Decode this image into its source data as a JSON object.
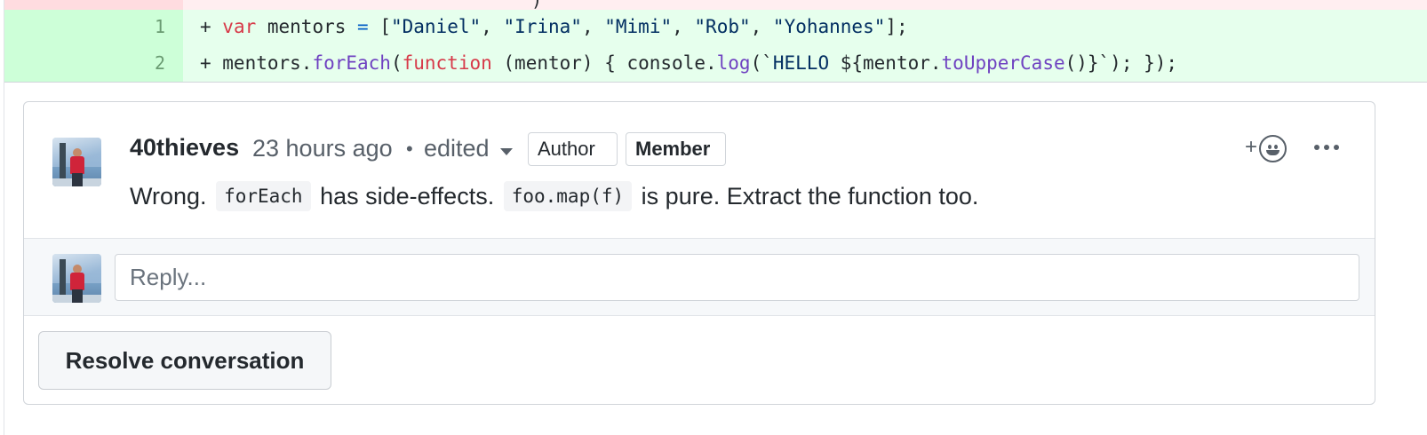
{
  "diff": {
    "removed_partial_glyph": ")",
    "lines": [
      {
        "number": "1"
      },
      {
        "number": "2"
      }
    ]
  },
  "comment": {
    "author": "40thieves",
    "timestamp": "23 hours ago",
    "separator": "•",
    "edited_label": "edited",
    "labels": {
      "author": "Author",
      "member": "Member"
    },
    "reaction_plus": "+",
    "body": {
      "seg1": "Wrong.",
      "code1": "forEach",
      "seg2": "has side-effects.",
      "code2": "foo.map(f)",
      "seg3": "is pure. Extract the function too."
    },
    "icons": {
      "reaction": "smiley-icon",
      "more": "kebab-horizontal-icon",
      "caret": "caret-down-icon"
    }
  },
  "reply": {
    "placeholder": "Reply..."
  },
  "resolve": {
    "label": "Resolve conversation"
  },
  "colors": {
    "added_bg": "#e6ffed",
    "added_num_bg": "#cdffd8",
    "removed_bg": "#ffeef0",
    "keyword": "#d73a49",
    "string": "#032f62",
    "function": "#6f42c1"
  }
}
